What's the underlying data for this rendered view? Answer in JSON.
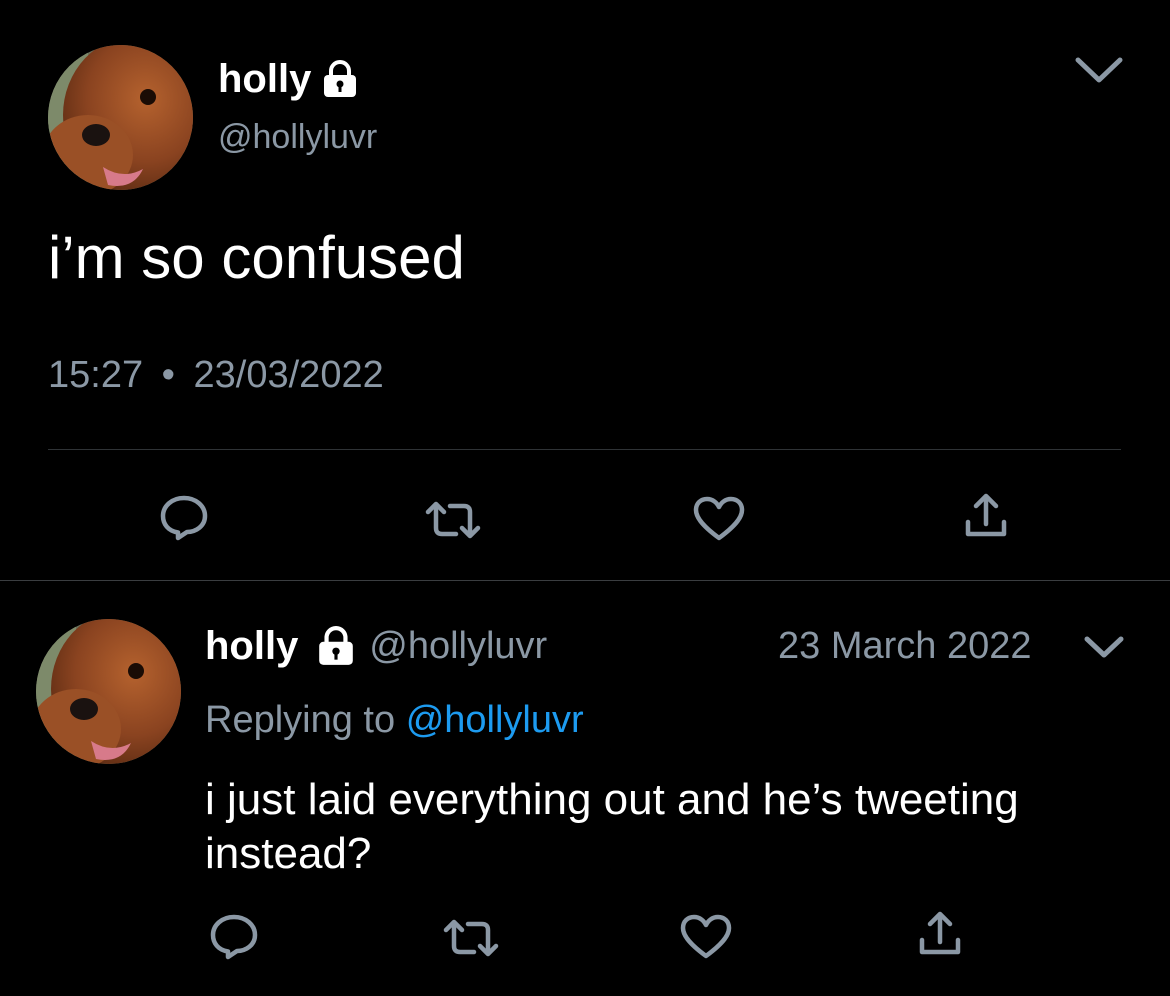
{
  "main_tweet": {
    "display_name": "holly",
    "handle": "@hollyluvr",
    "text": "i’m so confused",
    "time": "15:27",
    "separator": "•",
    "date": "23/03/2022",
    "avatar_icon": "dog-avatar",
    "locked_icon": "lock-icon",
    "menu_icon": "chevron-down-icon",
    "actions": [
      {
        "name": "reply",
        "icon": "reply-icon"
      },
      {
        "name": "retweet",
        "icon": "retweet-icon"
      },
      {
        "name": "like",
        "icon": "heart-icon"
      },
      {
        "name": "share",
        "icon": "share-icon"
      }
    ]
  },
  "reply_tweet": {
    "display_name": "holly",
    "handle": "@hollyluvr",
    "date": "23 March 2022",
    "replying_prefix": "Replying to",
    "replying_handle": "@hollyluvr",
    "text_line1": "i just laid everything out and he’s tweeting",
    "text_line2": "instead?",
    "avatar_icon": "dog-avatar",
    "locked_icon": "lock-icon",
    "menu_icon": "chevron-down-icon"
  },
  "colors": {
    "background": "#000000",
    "text": "#ffffff",
    "muted": "#8b98a5",
    "link": "#1d9bf0",
    "icon": "#8b98a5"
  }
}
